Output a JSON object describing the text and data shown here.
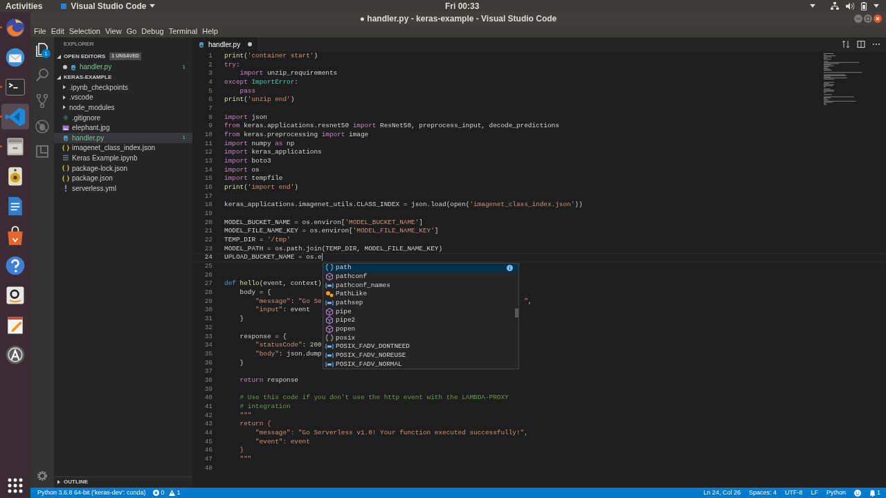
{
  "top_bar": {
    "activities": "Activities",
    "app_menu": "Visual Studio Code",
    "clock": "Fri 00:33"
  },
  "dock": [
    {
      "kind": "browser",
      "running": true,
      "selected": false
    },
    {
      "kind": "mail",
      "running": false,
      "selected": false
    },
    {
      "kind": "terminal",
      "running": true,
      "selected": false
    },
    {
      "kind": "code",
      "running": true,
      "selected": true
    },
    {
      "kind": "files",
      "running": true,
      "selected": false
    },
    {
      "kind": "speaker",
      "running": false,
      "selected": false
    },
    {
      "kind": "document",
      "running": false,
      "selected": false
    },
    {
      "kind": "bag",
      "running": false,
      "selected": false
    },
    {
      "kind": "help",
      "running": false,
      "selected": false
    },
    {
      "kind": "smile",
      "running": false,
      "selected": false
    },
    {
      "kind": "notepad",
      "running": false,
      "selected": false
    },
    {
      "kind": "updater",
      "running": false,
      "selected": false
    }
  ],
  "window": {
    "title": "● handler.py - keras-example - Visual Studio Code"
  },
  "menu": [
    "File",
    "Edit",
    "Selection",
    "View",
    "Go",
    "Debug",
    "Terminal",
    "Help"
  ],
  "activity_bar": [
    {
      "kind": "files",
      "selected": true,
      "badge": "1"
    },
    {
      "kind": "search",
      "selected": false
    },
    {
      "kind": "scm",
      "selected": false
    },
    {
      "kind": "debug",
      "selected": false
    },
    {
      "kind": "extensions",
      "selected": false
    }
  ],
  "sidebar": {
    "title": "EXPLORER",
    "open_editors": {
      "label": "OPEN EDITORS",
      "badge": "1 UNSAVED",
      "expanded": true,
      "items": [
        {
          "name": "handler.py",
          "kind": "python",
          "dirty": true,
          "count": "1"
        }
      ]
    },
    "project": {
      "label": "KERAS-EXAMPLE",
      "expanded": true,
      "items": [
        {
          "name": ".ipynb_checkpoints",
          "kind": "folder",
          "selected": false
        },
        {
          "name": ".vscode",
          "kind": "folder",
          "selected": false
        },
        {
          "name": "node_modules",
          "kind": "folder",
          "selected": false
        },
        {
          "name": ".gitignore",
          "kind": "git",
          "selected": false
        },
        {
          "name": "elephant.jpg",
          "kind": "image",
          "selected": false
        },
        {
          "name": "handler.py",
          "kind": "python",
          "selected": true,
          "count": "1"
        },
        {
          "name": "imagenet_class_index.json",
          "kind": "json",
          "selected": false
        },
        {
          "name": "Keras Example.ipynb",
          "kind": "notebook",
          "selected": false
        },
        {
          "name": "package-lock.json",
          "kind": "json",
          "selected": false
        },
        {
          "name": "package.json",
          "kind": "json",
          "selected": false
        },
        {
          "name": "serverless.yml",
          "kind": "yaml",
          "selected": false
        }
      ]
    },
    "outline": {
      "label": "OUTLINE",
      "expanded": false
    }
  },
  "tabs": [
    {
      "label": "handler.py",
      "selected": true,
      "dirty": true
    }
  ],
  "code": [
    {
      "n": "1",
      "cur": false,
      "code": [
        {
          "kind": "function",
          "text": "print"
        },
        {
          "kind": "plain",
          "text": "("
        },
        {
          "kind": "string",
          "text": "'container start'"
        },
        {
          "kind": "plain",
          "text": ")"
        }
      ]
    },
    {
      "n": "2",
      "cur": false,
      "code": [
        {
          "kind": "keyword",
          "text": "try"
        },
        {
          "kind": "plain",
          "text": ":"
        }
      ]
    },
    {
      "n": "3",
      "cur": false,
      "code": [
        {
          "kind": "keyword",
          "text": "    import"
        },
        {
          "kind": "plain",
          "text": " unzip_requirements"
        }
      ]
    },
    {
      "n": "4",
      "cur": false,
      "code": [
        {
          "kind": "keyword",
          "text": "except"
        },
        {
          "kind": "type",
          "text": " ImportError"
        },
        {
          "kind": "plain",
          "text": ":"
        }
      ]
    },
    {
      "n": "5",
      "cur": false,
      "code": [
        {
          "kind": "keyword",
          "text": "    pass"
        }
      ]
    },
    {
      "n": "6",
      "cur": false,
      "code": [
        {
          "kind": "function",
          "text": "print"
        },
        {
          "kind": "plain",
          "text": "("
        },
        {
          "kind": "string",
          "text": "'unzip end'"
        },
        {
          "kind": "plain",
          "text": ")"
        }
      ]
    },
    {
      "n": "7",
      "cur": false
    },
    {
      "n": "8",
      "cur": false,
      "code": [
        {
          "kind": "keyword",
          "text": "import"
        },
        {
          "kind": "plain",
          "text": " json"
        }
      ]
    },
    {
      "n": "9",
      "cur": false,
      "code": [
        {
          "kind": "keyword",
          "text": "from"
        },
        {
          "kind": "plain",
          "text": " keras.applications.resnet50 "
        },
        {
          "kind": "keyword",
          "text": "import"
        },
        {
          "kind": "plain",
          "text": " ResNet50, preprocess_input, decode_predictions"
        }
      ]
    },
    {
      "n": "10",
      "cur": false,
      "code": [
        {
          "kind": "keyword",
          "text": "from"
        },
        {
          "kind": "plain",
          "text": " keras.preprocessing "
        },
        {
          "kind": "keyword",
          "text": "import"
        },
        {
          "kind": "plain",
          "text": " image"
        }
      ]
    },
    {
      "n": "11",
      "cur": false,
      "code": [
        {
          "kind": "keyword",
          "text": "import"
        },
        {
          "kind": "plain",
          "text": " numpy "
        },
        {
          "kind": "keyword",
          "text": "as"
        },
        {
          "kind": "plain",
          "text": " np"
        }
      ]
    },
    {
      "n": "12",
      "cur": false,
      "code": [
        {
          "kind": "keyword",
          "text": "import"
        },
        {
          "kind": "plain",
          "text": " keras_applications"
        }
      ]
    },
    {
      "n": "13",
      "cur": false,
      "code": [
        {
          "kind": "keyword",
          "text": "import"
        },
        {
          "kind": "plain",
          "text": " boto3"
        }
      ]
    },
    {
      "n": "14",
      "cur": false,
      "code": [
        {
          "kind": "keyword",
          "text": "import"
        },
        {
          "kind": "plain",
          "text": " os"
        }
      ]
    },
    {
      "n": "15",
      "cur": false,
      "code": [
        {
          "kind": "keyword",
          "text": "import"
        },
        {
          "kind": "plain",
          "text": " tempfile"
        }
      ]
    },
    {
      "n": "16",
      "cur": false,
      "code": [
        {
          "kind": "function",
          "text": "print"
        },
        {
          "kind": "plain",
          "text": "("
        },
        {
          "kind": "string",
          "text": "'import end'"
        },
        {
          "kind": "plain",
          "text": ")"
        }
      ]
    },
    {
      "n": "17",
      "cur": false
    },
    {
      "n": "18",
      "cur": false,
      "code": [
        {
          "kind": "plain",
          "text": "keras_applications.imagenet_utils.CLASS_INDEX = json.load(open("
        },
        {
          "kind": "string",
          "text": "'imagenet_class_index.json'"
        },
        {
          "kind": "plain",
          "text": "))"
        }
      ]
    },
    {
      "n": "19",
      "cur": false
    },
    {
      "n": "20",
      "cur": false,
      "code": [
        {
          "kind": "plain",
          "text": "MODEL_BUCKET_NAME = os.environ["
        },
        {
          "kind": "string",
          "text": "'MODEL_BUCKET_NAME'"
        },
        {
          "kind": "plain",
          "text": "]"
        }
      ]
    },
    {
      "n": "21",
      "cur": false,
      "code": [
        {
          "kind": "plain",
          "text": "MODEL_FILE_NAME_KEY = os.environ["
        },
        {
          "kind": "string",
          "text": "'MODEL_FILE_NAME_KEY'"
        },
        {
          "kind": "plain",
          "text": "]"
        }
      ]
    },
    {
      "n": "22",
      "cur": false,
      "code": [
        {
          "kind": "plain",
          "text": "TEMP_DIR = "
        },
        {
          "kind": "string",
          "text": "'/tmp'"
        }
      ]
    },
    {
      "n": "23",
      "cur": false,
      "code": [
        {
          "kind": "plain",
          "text": "MODEL_PATH = os.path.join(TEMP_DIR, MODEL_FILE_NAME_KEY)"
        }
      ]
    },
    {
      "n": "24",
      "cur": true,
      "code": [
        {
          "kind": "plain",
          "text": "UPLOAD_BUCKET_NAME = os.e"
        }
      ]
    },
    {
      "n": "25",
      "cur": false
    },
    {
      "n": "26",
      "cur": false
    },
    {
      "n": "27",
      "cur": false,
      "code": [
        {
          "kind": "def",
          "text": "def"
        },
        {
          "kind": "function",
          "text": " hello"
        },
        {
          "kind": "plain",
          "text": "(event, context)"
        }
      ]
    },
    {
      "n": "28",
      "cur": false,
      "code": [
        {
          "kind": "plain",
          "text": "    body = {"
        }
      ]
    },
    {
      "n": "29",
      "cur": false,
      "code": [
        {
          "kind": "string",
          "text": "        \"message\""
        },
        {
          "kind": "plain",
          "text": ": "
        },
        {
          "kind": "string",
          "text": "\"Go Se"
        }
      ],
      "tail": [
        {
          "kind": "string",
          "text": "\""
        },
        {
          "kind": "plain",
          "text": ","
        }
      ]
    },
    {
      "n": "30",
      "cur": false,
      "code": [
        {
          "kind": "string",
          "text": "        \"input\""
        },
        {
          "kind": "plain",
          "text": ": event"
        }
      ]
    },
    {
      "n": "31",
      "cur": false,
      "code": [
        {
          "kind": "plain",
          "text": "    }"
        }
      ]
    },
    {
      "n": "32",
      "cur": false
    },
    {
      "n": "33",
      "cur": false,
      "code": [
        {
          "kind": "plain",
          "text": "    response = {"
        }
      ]
    },
    {
      "n": "34",
      "cur": false,
      "code": [
        {
          "kind": "string",
          "text": "        \"statusCode\""
        },
        {
          "kind": "plain",
          "text": ": "
        },
        {
          "kind": "number",
          "text": "200"
        }
      ]
    },
    {
      "n": "35",
      "cur": false,
      "code": [
        {
          "kind": "string",
          "text": "        \"body\""
        },
        {
          "kind": "plain",
          "text": ": json.dump"
        }
      ]
    },
    {
      "n": "36",
      "cur": false,
      "code": [
        {
          "kind": "plain",
          "text": "    }"
        }
      ]
    },
    {
      "n": "37",
      "cur": false
    },
    {
      "n": "38",
      "cur": false,
      "code": [
        {
          "kind": "keyword",
          "text": "    return"
        },
        {
          "kind": "plain",
          "text": " response"
        }
      ]
    },
    {
      "n": "39",
      "cur": false
    },
    {
      "n": "40",
      "cur": false,
      "code": [
        {
          "kind": "comment",
          "text": "    # Use this code if you don't use the http event with the LAMBDA-PROXY"
        }
      ]
    },
    {
      "n": "41",
      "cur": false,
      "code": [
        {
          "kind": "comment",
          "text": "    # integration"
        }
      ]
    },
    {
      "n": "42",
      "cur": false,
      "code": [
        {
          "kind": "string",
          "text": "    \"\"\""
        }
      ]
    },
    {
      "n": "43",
      "cur": false,
      "code": [
        {
          "kind": "string",
          "text": "    return {"
        }
      ]
    },
    {
      "n": "44",
      "cur": false,
      "code": [
        {
          "kind": "string",
          "text": "        \"message\": \"Go Serverless v1.0! Your function executed successfully!\","
        }
      ]
    },
    {
      "n": "45",
      "cur": false,
      "code": [
        {
          "kind": "string",
          "text": "        \"event\": event"
        }
      ]
    },
    {
      "n": "46",
      "cur": false,
      "code": [
        {
          "kind": "string",
          "text": "    }"
        }
      ]
    },
    {
      "n": "47",
      "cur": false,
      "code": [
        {
          "kind": "string",
          "text": "    \"\"\""
        }
      ]
    },
    {
      "n": "48",
      "cur": false
    }
  ],
  "suggestions": [
    {
      "label": "path",
      "kind": "module",
      "selected": true
    },
    {
      "label": "pathconf",
      "kind": "function",
      "selected": false
    },
    {
      "label": "pathconf_names",
      "kind": "field",
      "selected": false
    },
    {
      "label": "PathLike",
      "kind": "class",
      "selected": false
    },
    {
      "label": "pathsep",
      "kind": "field",
      "selected": false
    },
    {
      "label": "pipe",
      "kind": "function",
      "selected": false
    },
    {
      "label": "pipe2",
      "kind": "function",
      "selected": false
    },
    {
      "label": "popen",
      "kind": "function",
      "selected": false
    },
    {
      "label": "posix",
      "kind": "module",
      "selected": false
    },
    {
      "label": "POSIX_FADV_DONTNEED",
      "kind": "field",
      "selected": false
    },
    {
      "label": "POSIX_FADV_NOREUSE",
      "kind": "field",
      "selected": false
    },
    {
      "label": "POSIX_FADV_NORMAL",
      "kind": "field",
      "selected": false
    }
  ],
  "status_bar": {
    "interpreter": "Python 3.6.8 64-bit ('keras-dev': conda)",
    "errors": "0",
    "warnings": "1",
    "right": [
      "Ln 24, Col 26",
      "Spaces: 4",
      "UTF-8",
      "LF",
      "Python"
    ],
    "notifications": "1"
  }
}
